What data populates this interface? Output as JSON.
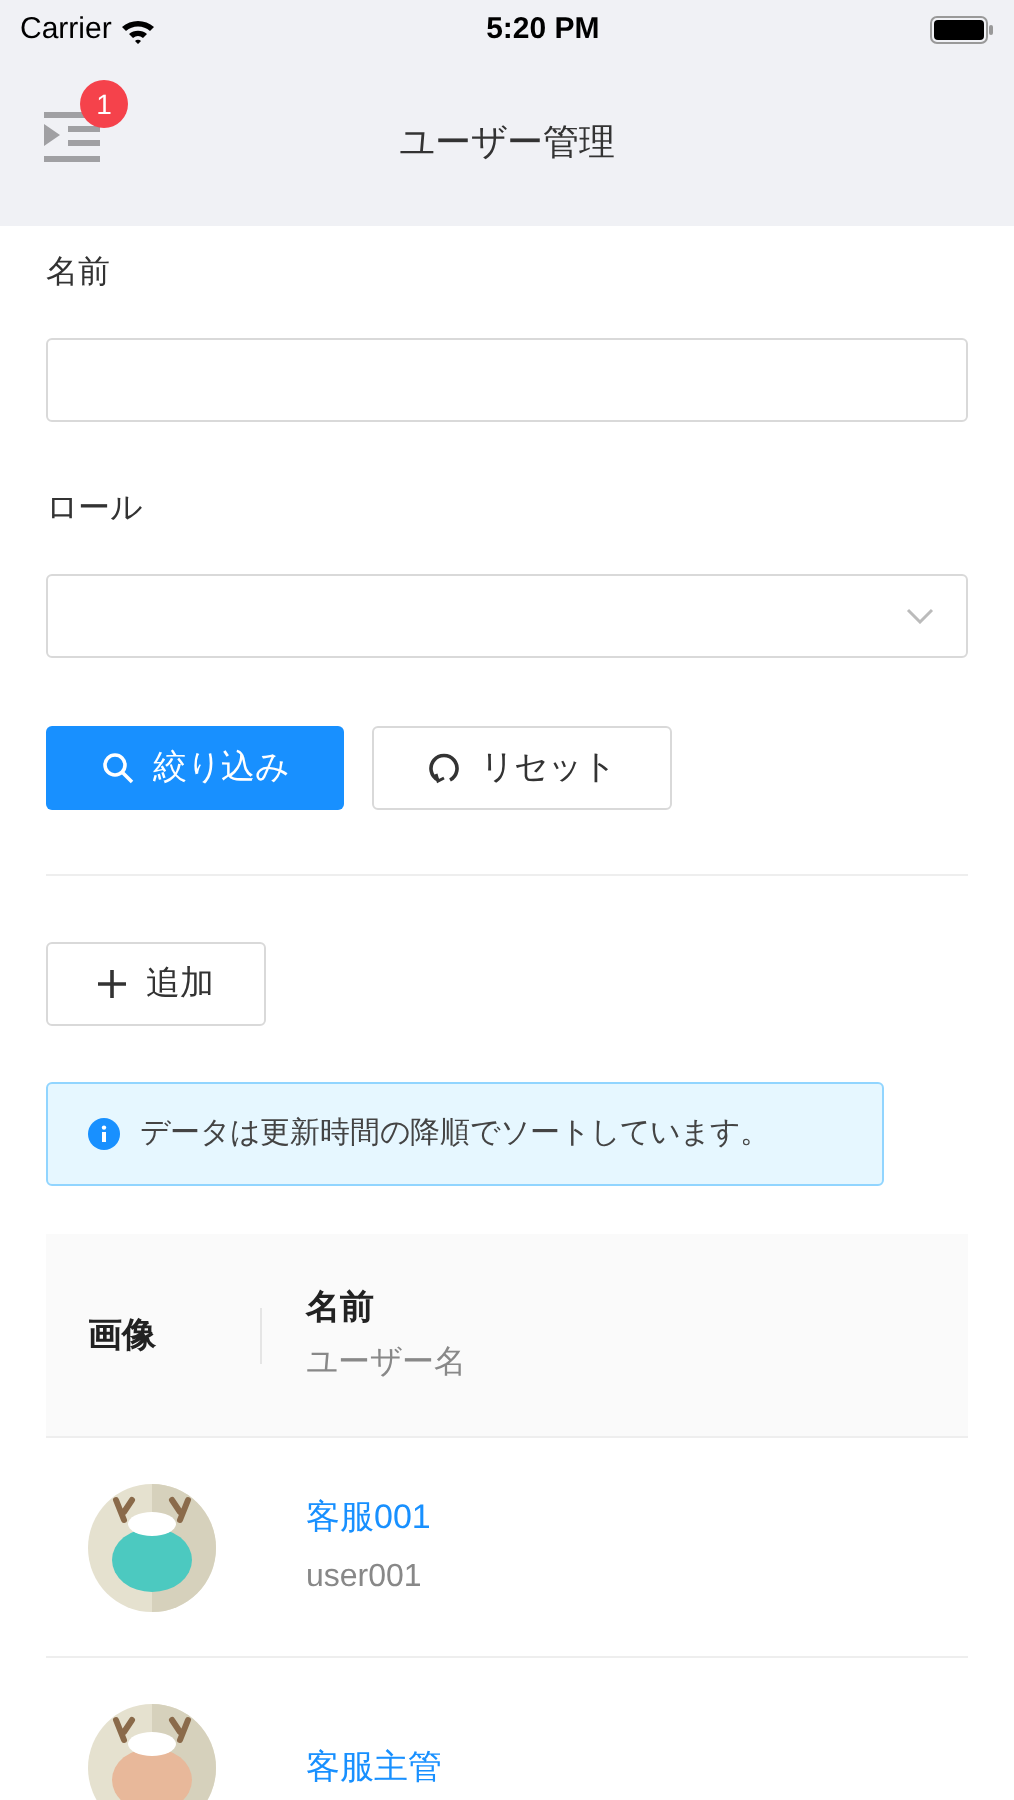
{
  "status_bar": {
    "carrier": "Carrier",
    "time": "5:20 PM"
  },
  "nav": {
    "title": "ユーザー管理",
    "badge": "1"
  },
  "form": {
    "fields": [
      {
        "label": "名前",
        "kind": "text"
      },
      {
        "label": "ロール",
        "kind": "select"
      }
    ],
    "buttons": [
      {
        "label": "絞り込み",
        "kind": "primary"
      },
      {
        "label": "リセット",
        "kind": "reset"
      }
    ]
  },
  "add_button": "追加",
  "alert": "データは更新時間の降順でソートしています。",
  "table": {
    "columns": [
      {
        "title": "画像"
      },
      {
        "title": "名前",
        "subtitle": "ユーザー名"
      }
    ],
    "rows": [
      {
        "name": "客服001",
        "username": "user001"
      },
      {
        "name": "客服主管"
      }
    ]
  }
}
